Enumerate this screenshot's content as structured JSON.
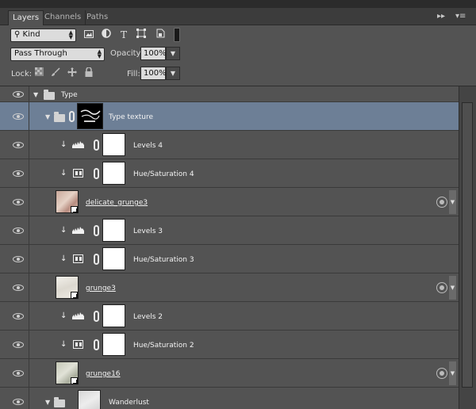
{
  "tabs": {
    "layers": "Layers",
    "channels": "Channels",
    "paths": "Paths"
  },
  "tab_controls": {
    "collapse": "▸▸",
    "menu": "▾≡"
  },
  "filter": {
    "kind_label": "Kind",
    "search_glyph": "⚲"
  },
  "filter_icons": {
    "pixel": "image-filter-icon",
    "adjustment": "adjustment-filter-icon",
    "type": "T",
    "shape": "shape-filter-icon",
    "smart": "smart-object-filter-icon"
  },
  "blend": {
    "mode": "Pass Through",
    "opacity_label": "Opacity:",
    "opacity": "100%"
  },
  "lock": {
    "label": "Lock:",
    "fill_label": "Fill:",
    "fill": "100%"
  },
  "layers": [
    {
      "name": "Type",
      "kind": "group-root"
    },
    {
      "name": "Type texture",
      "kind": "group"
    },
    {
      "name": "Levels 4",
      "kind": "levels"
    },
    {
      "name": "Hue/Saturation 4",
      "kind": "huesat"
    },
    {
      "name": "delicate_grunge3",
      "kind": "smart"
    },
    {
      "name": "Levels 3",
      "kind": "levels"
    },
    {
      "name": "Hue/Saturation 3",
      "kind": "huesat"
    },
    {
      "name": "grunge3",
      "kind": "smart"
    },
    {
      "name": "Levels 2",
      "kind": "levels"
    },
    {
      "name": "Hue/Saturation 2",
      "kind": "huesat"
    },
    {
      "name": "grunge16",
      "kind": "smart"
    },
    {
      "name": "Wanderlust",
      "kind": "group-thumb"
    }
  ],
  "colors": {
    "panel": "#535353",
    "selected": "#6d7f96",
    "tabbar": "#3c3c3c"
  }
}
